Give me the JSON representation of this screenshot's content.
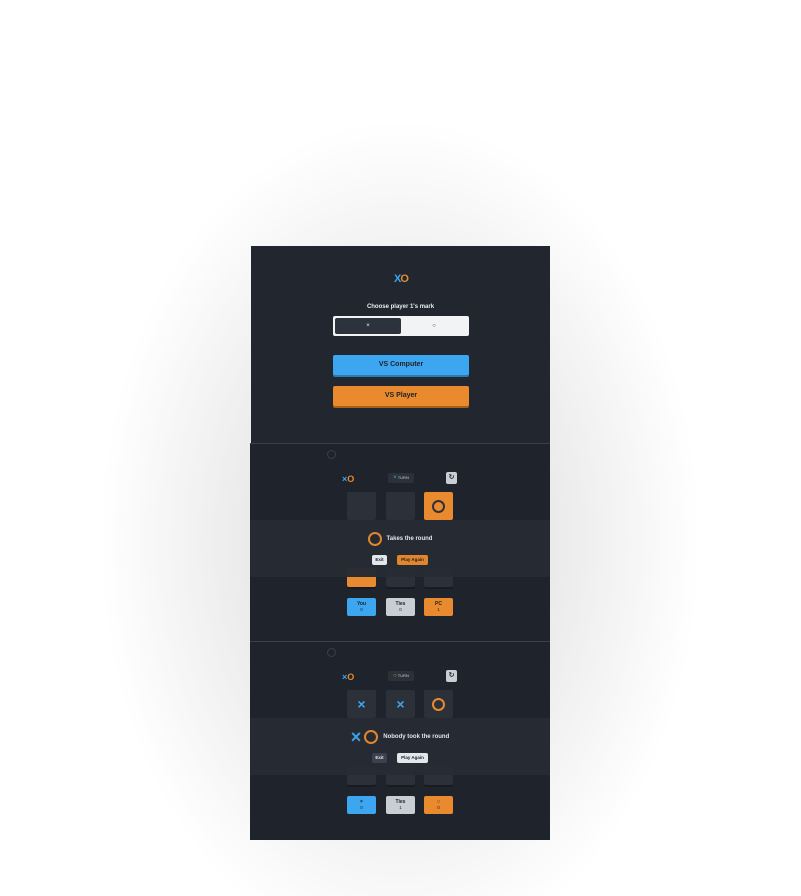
{
  "menu": {
    "logo_x": "X",
    "logo_o": "O",
    "title": "Choose player 1's mark",
    "mark_x": "×",
    "mark_o": "○",
    "vs_computer": "VS Computer",
    "vs_player": "VS Player"
  },
  "game1": {
    "logo_x": "×",
    "logo_o": "O",
    "turn_mark": "×",
    "turn_label": "TURN",
    "restart_icon": "↻",
    "result_text": "Takes the round",
    "exit_label": "Exit",
    "again_label": "Play Again",
    "scores": [
      {
        "label": "You",
        "value": "0"
      },
      {
        "label": "Ties",
        "value": "0"
      },
      {
        "label": "PC",
        "value": "1"
      }
    ]
  },
  "game2": {
    "logo_x": "×",
    "logo_o": "O",
    "turn_mark": "○",
    "turn_label": "TURN",
    "restart_icon": "↻",
    "result_x": "×",
    "result_text": "Nobody took the round",
    "exit_label": "Exit",
    "again_label": "Play Again",
    "scores": [
      {
        "label": "×",
        "value": "0"
      },
      {
        "label": "Ties",
        "value": "1"
      },
      {
        "label": "○",
        "value": "0"
      }
    ]
  },
  "colors": {
    "x_mark": "#3ca6f0",
    "o_mark": "#e88a2d",
    "background": "#1f232b"
  }
}
